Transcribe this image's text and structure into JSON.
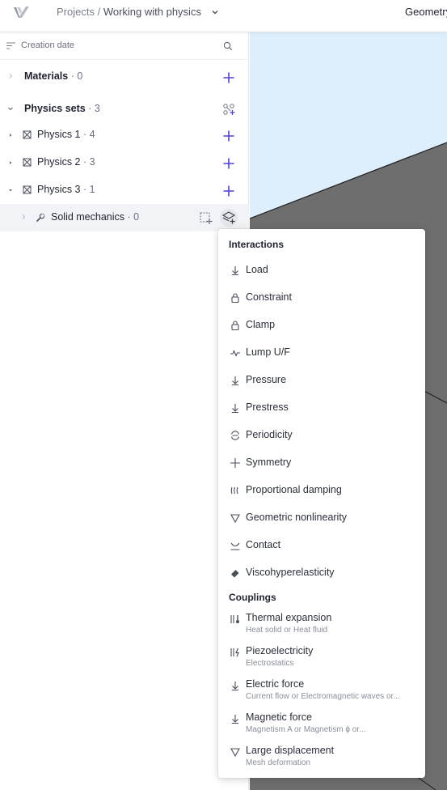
{
  "header": {
    "breadcrumb_root": "Projects /",
    "project_name": "Working with physics",
    "tab_label": "Geometry"
  },
  "sidebar": {
    "sort_label": "Creation date",
    "materials": {
      "label": "Materials",
      "count": "· 0"
    },
    "physics_sets": {
      "label": "Physics sets",
      "count": "· 3"
    },
    "items": [
      {
        "label": "Physics 1",
        "count": "· 4"
      },
      {
        "label": "Physics 2",
        "count": "· 3"
      },
      {
        "label": "Physics 3",
        "count": "· 1"
      }
    ],
    "sub_item": {
      "label": "Solid mechanics",
      "count": "· 0"
    }
  },
  "menu": {
    "interactions_title": "Interactions",
    "interactions": [
      {
        "label": "Load",
        "icon": "arrow-down-icon"
      },
      {
        "label": "Constraint",
        "icon": "lock-icon"
      },
      {
        "label": "Clamp",
        "icon": "lock-icon"
      },
      {
        "label": "Lump U/F",
        "icon": "wave-icon"
      },
      {
        "label": "Pressure",
        "icon": "arrow-down-icon"
      },
      {
        "label": "Prestress",
        "icon": "arrow-down-icon"
      },
      {
        "label": "Periodicity",
        "icon": "cycle-icon"
      },
      {
        "label": "Symmetry",
        "icon": "cross-icon"
      },
      {
        "label": "Proportional damping",
        "icon": "damping-icon"
      },
      {
        "label": "Geometric nonlinearity",
        "icon": "triangle-down-icon"
      },
      {
        "label": "Contact",
        "icon": "contact-icon"
      },
      {
        "label": "Viscohyperelasticity",
        "icon": "eraser-icon"
      }
    ],
    "couplings_title": "Couplings",
    "couplings": [
      {
        "label": "Thermal expansion",
        "sub": "Heat solid or Heat fluid",
        "icon": "thermometer-icon"
      },
      {
        "label": "Piezoelectricity",
        "sub": "Electrostatics",
        "icon": "piezo-icon"
      },
      {
        "label": "Electric force",
        "sub": "Current flow or Electromagnetic waves or...",
        "icon": "arrow-down-icon"
      },
      {
        "label": "Magnetic force",
        "sub": "Magnetism A or Magnetism ϕ or...",
        "icon": "arrow-down-icon"
      },
      {
        "label": "Large displacement",
        "sub": "Mesh deformation",
        "icon": "triangle-down-icon"
      }
    ]
  },
  "colors": {
    "accent": "#4b3fd8",
    "canvas_sky": "#ddeefc",
    "canvas_solid": "#6e6e6e"
  }
}
